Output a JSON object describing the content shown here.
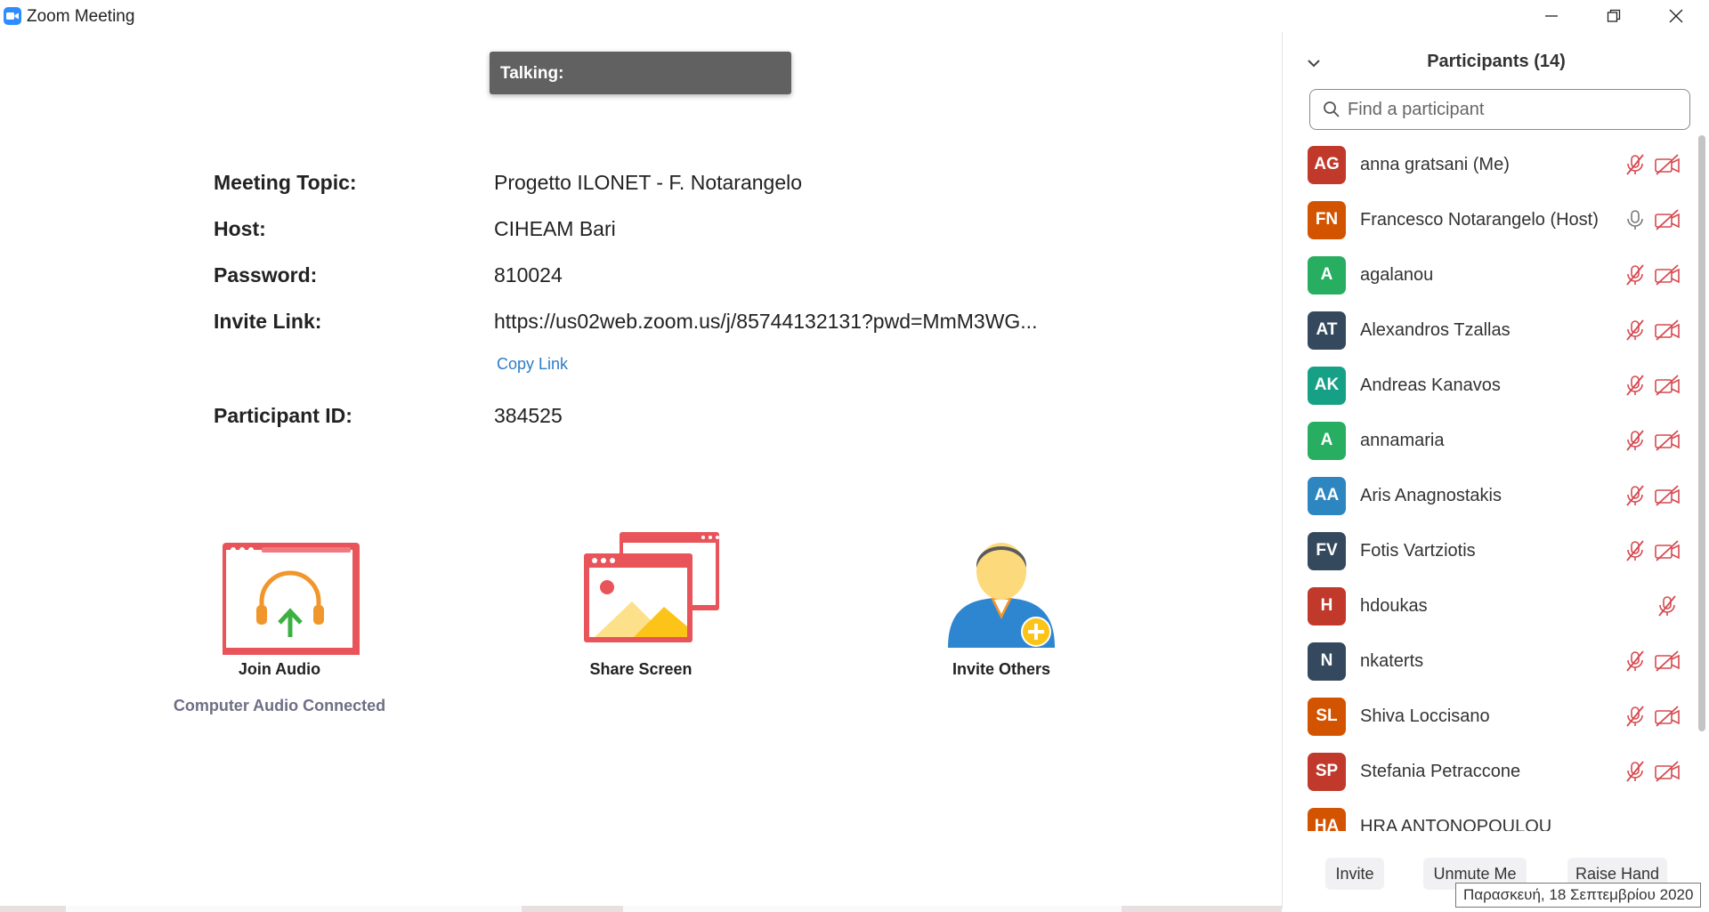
{
  "window": {
    "title": "Zoom Meeting",
    "icon": "zoom-camera-icon",
    "controls": [
      "minimize-icon",
      "restore-icon",
      "close-icon"
    ]
  },
  "main": {
    "talking_label": "Talking:",
    "info": [
      {
        "label": "Meeting Topic:",
        "value": "Progetto ILONET - F. Notarangelo"
      },
      {
        "label": "Host:",
        "value": "CIHEAM Bari"
      },
      {
        "label": "Password:",
        "value": "810024"
      },
      {
        "label": "Invite Link:",
        "value": "https://us02web.zoom.us/j/85744132131?pwd=MmM3WG..."
      },
      {
        "label": "Participant ID:",
        "value": "384525"
      }
    ],
    "copy_link_label": "Copy Link",
    "actions": [
      {
        "label": "Join Audio",
        "sublabel": "Computer Audio Connected",
        "icon": "join-audio-icon"
      },
      {
        "label": "Share Screen",
        "icon": "share-screen-icon"
      },
      {
        "label": "Invite Others",
        "icon": "invite-others-icon"
      }
    ]
  },
  "sidebar": {
    "title": "Participants (14)",
    "search_placeholder": "Find a participant",
    "participants": [
      {
        "initials": "AG",
        "name": "anna gratsani (Me)",
        "color": "#c0392b",
        "mic": "muted",
        "video": "off"
      },
      {
        "initials": "FN",
        "name": "Francesco Notarangelo (Host)",
        "color": "#d35400",
        "mic": "on",
        "video": "off"
      },
      {
        "initials": "A",
        "name": "agalanou",
        "color": "#27ae60",
        "mic": "muted",
        "video": "off"
      },
      {
        "initials": "AT",
        "name": "Alexandros Tzallas",
        "color": "#34495e",
        "mic": "muted",
        "video": "off"
      },
      {
        "initials": "AK",
        "name": "Andreas Kanavos",
        "color": "#16a085",
        "mic": "muted",
        "video": "off"
      },
      {
        "initials": "A",
        "name": "annamaria",
        "color": "#27ae60",
        "mic": "muted",
        "video": "off"
      },
      {
        "initials": "AA",
        "name": "Aris Anagnostakis",
        "color": "#2e86c1",
        "mic": "muted",
        "video": "off"
      },
      {
        "initials": "FV",
        "name": "Fotis Vartziotis",
        "color": "#34495e",
        "mic": "muted",
        "video": "off"
      },
      {
        "initials": "H",
        "name": "hdoukas",
        "color": "#c0392b",
        "mic": "muted",
        "video": "none"
      },
      {
        "initials": "N",
        "name": "nkaterts",
        "color": "#34495e",
        "mic": "muted",
        "video": "off"
      },
      {
        "initials": "SL",
        "name": "Shiva Loccisano",
        "color": "#d35400",
        "mic": "muted",
        "video": "off"
      },
      {
        "initials": "SP",
        "name": "Stefania Petraccone",
        "color": "#c0392b",
        "mic": "muted",
        "video": "off"
      },
      {
        "initials": "HA",
        "name": "HRA ANTONOPOULOU",
        "color": "#d35400",
        "mic": "none",
        "video": "none"
      }
    ],
    "footer": {
      "invite_label": "Invite",
      "unmute_label": "Unmute Me",
      "raise_hand_label": "Raise Hand"
    }
  },
  "tooltip": "Παρασκευή, 18 Σεπτεμβρίου 2020"
}
